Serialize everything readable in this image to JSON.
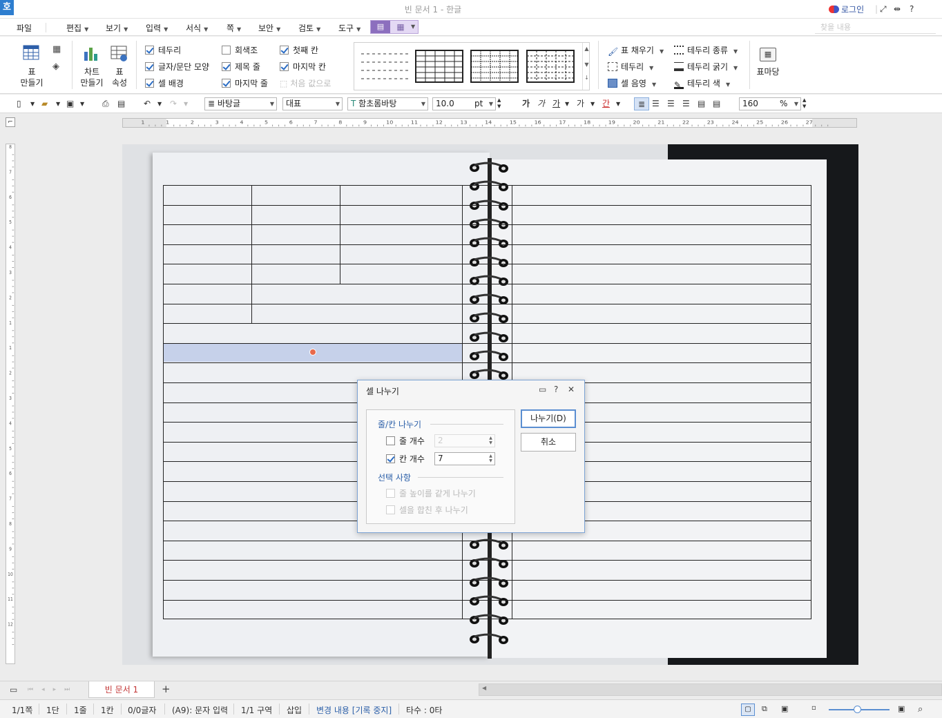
{
  "titlebar": {
    "app_icon": "호",
    "title": "빈 문서 1 - 한글",
    "login": "로그인",
    "controls": [
      "⤢",
      "⇹",
      "?"
    ]
  },
  "menu": {
    "items": [
      {
        "label": "파일",
        "dropdown": false
      },
      {
        "label": "편집",
        "dropdown": true
      },
      {
        "label": "보기",
        "dropdown": true
      },
      {
        "label": "입력",
        "dropdown": true
      },
      {
        "label": "서식",
        "dropdown": true
      },
      {
        "label": "쪽",
        "dropdown": true
      },
      {
        "label": "보안",
        "dropdown": true
      },
      {
        "label": "검토",
        "dropdown": true
      },
      {
        "label": "도구",
        "dropdown": true
      }
    ],
    "search_placeholder": "찾을 내용"
  },
  "ribbon": {
    "table_make": "표\n만들기",
    "chart_make": "차트\n만들기",
    "table_props": "표\n속성",
    "checks": [
      {
        "label": "테두리",
        "checked": true,
        "disabled": false
      },
      {
        "label": "글자/문단 모양",
        "checked": true,
        "disabled": false
      },
      {
        "label": "셀 배경",
        "checked": true,
        "disabled": false
      },
      {
        "label": "회색조",
        "checked": false,
        "disabled": false
      },
      {
        "label": "제목 줄",
        "checked": true,
        "disabled": false
      },
      {
        "label": "마지막 줄",
        "checked": true,
        "disabled": false
      },
      {
        "label": "첫째 칸",
        "checked": true,
        "disabled": false
      },
      {
        "label": "마지막 칸",
        "checked": true,
        "disabled": false
      }
    ],
    "reset": "처음 값으로",
    "fill": "표 채우기",
    "border": "테두리",
    "cell_shade": "셀 음영",
    "border_type": "테두리 종류",
    "border_width": "테두리 굵기",
    "border_color": "테두리 색",
    "table_yard": "표마당"
  },
  "toolbar": {
    "style": "바탕글",
    "lang": "대표",
    "font": "함초롬바탕",
    "size": "10.0",
    "unit": "pt",
    "zoom": "160",
    "zoom_unit": "%",
    "char_btns": [
      "가",
      "가",
      "가",
      "가",
      "간"
    ]
  },
  "ruler": {
    "h_ticks": [
      "1",
      "1",
      "2",
      "3",
      "4",
      "5",
      "6",
      "7",
      "8",
      "9",
      "10",
      "11",
      "12",
      "13",
      "14",
      "15",
      "16",
      "17",
      "18",
      "19",
      "20",
      "21",
      "22",
      "23",
      "24",
      "25",
      "26",
      "27"
    ],
    "v_ticks": [
      "8",
      "7",
      "6",
      "5",
      "4",
      "3",
      "2",
      "1",
      "1",
      "2",
      "3",
      "4",
      "5",
      "6",
      "7",
      "8",
      "9",
      "10",
      "11",
      "12"
    ]
  },
  "dialog": {
    "title": "셀 나누기",
    "group1": "줄/칸 나누기",
    "rows_label": "줄 개수",
    "rows_checked": false,
    "rows_value": "2",
    "cols_label": "칸 개수",
    "cols_checked": true,
    "cols_value": "7",
    "group2": "선택 사항",
    "opt1": "줄 높이를 같게 나누기",
    "opt2": "셀을 합친 후 나누기",
    "ok": "나누기(D)",
    "cancel": "취소"
  },
  "tabs": {
    "doc": "빈 문서 1",
    "add": "+"
  },
  "status": {
    "page": "1/1쪽",
    "dan": "1단",
    "line": "1줄",
    "col": "1칸",
    "chars": "0/0글자",
    "cell": "(A9): 문자 입력",
    "section": "1/1 구역",
    "mode": "삽입",
    "track": "변경 내용 [기록 중지]",
    "taps": "타수 : 0타"
  }
}
